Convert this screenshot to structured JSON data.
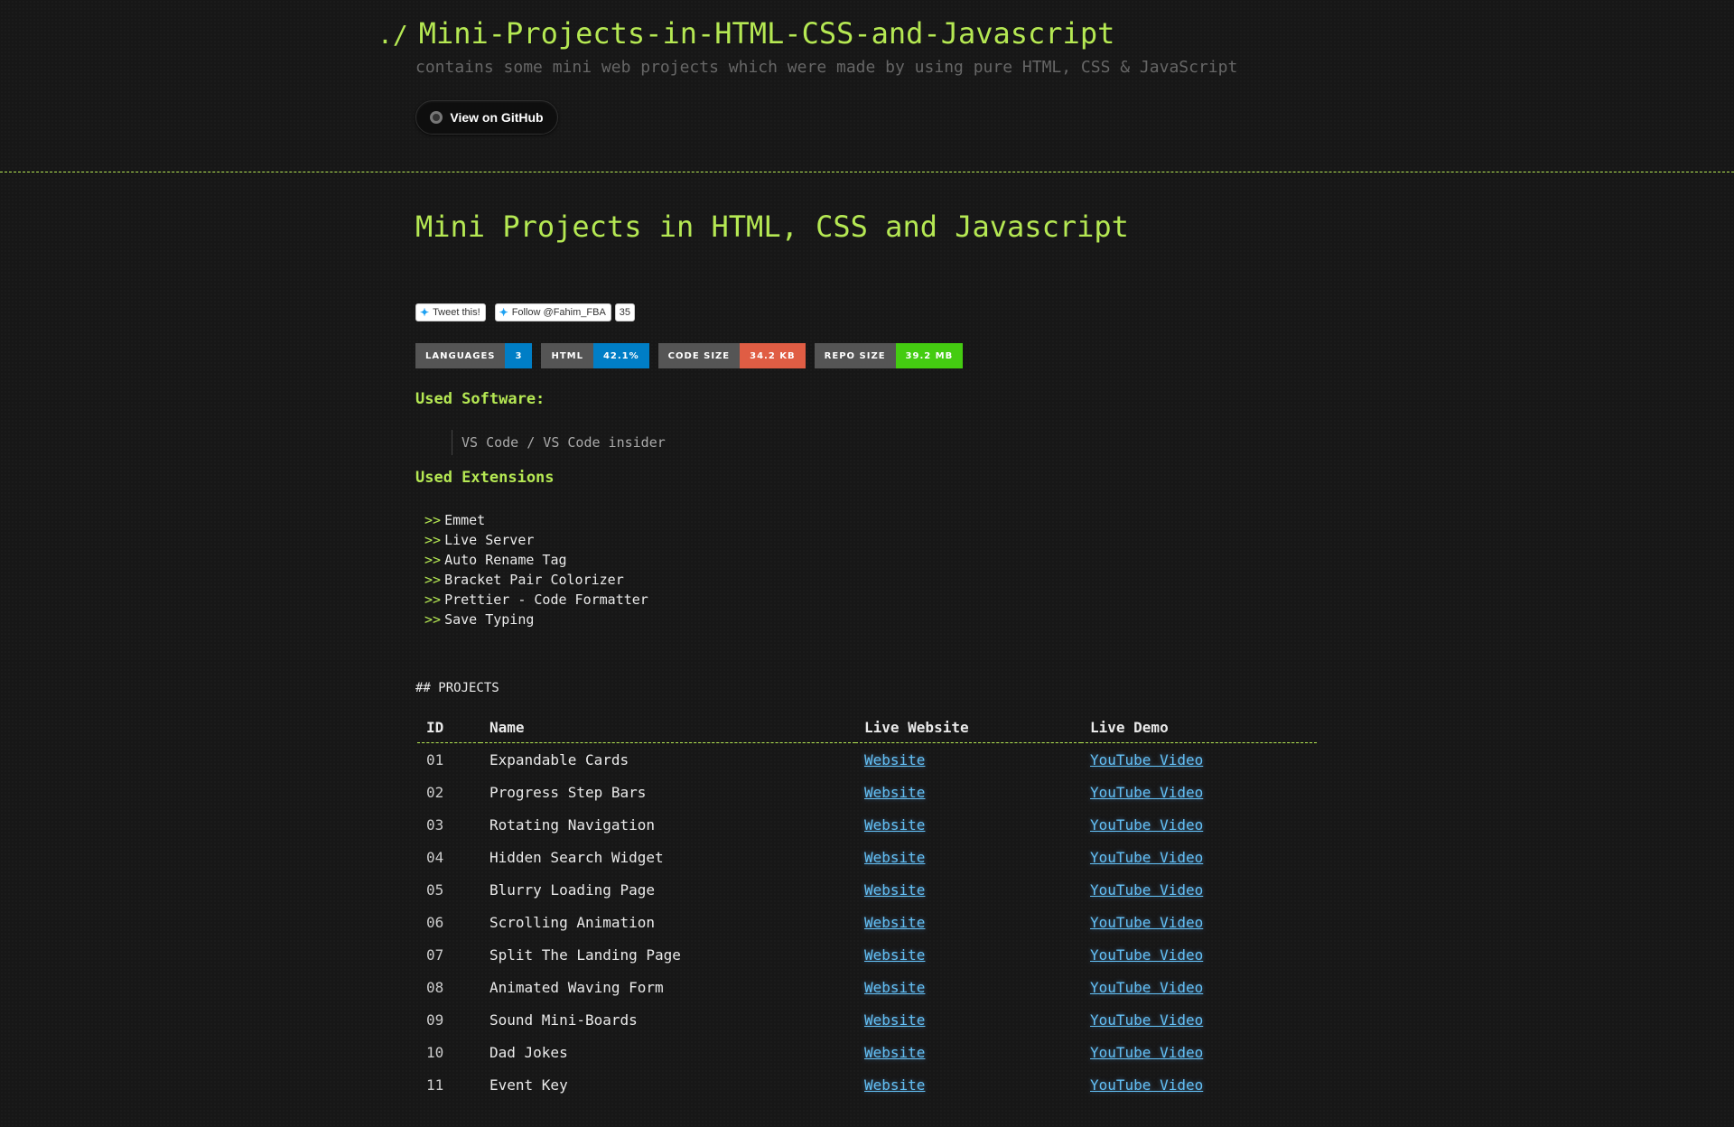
{
  "header": {
    "prompt": "./",
    "repo_title": "Mini-Projects-in-HTML-CSS-and-Javascript",
    "tagline": "contains some mini web projects which were made by using pure HTML, CSS & JavaScript",
    "github_button": "View on GitHub",
    "github_icon": "github-icon"
  },
  "main": {
    "heading": "Mini Projects in HTML, CSS and Javascript",
    "social": {
      "tweet_label": "Tweet this!",
      "follow_label": "Follow @Fahim_FBA",
      "follow_count": "35",
      "bird_icon": "twitter-bird-icon"
    },
    "badges": [
      {
        "label": "LANGUAGES",
        "value": "3",
        "color": "#007ec6"
      },
      {
        "label": "HTML",
        "value": "42.1%",
        "color": "#007ec6"
      },
      {
        "label": "CODE SIZE",
        "value": "34.2 KB",
        "color": "#e05d44"
      },
      {
        "label": "REPO SIZE",
        "value": "39.2 MB",
        "color": "#4c1"
      }
    ],
    "software_heading": "Used Software:",
    "software_item": "VS Code / VS Code insider",
    "extensions_heading": "Used Extensions",
    "extension_marker": ">>",
    "extensions": [
      "Emmet",
      "Live Server",
      "Auto Rename Tag",
      "Bracket Pair Colorizer",
      "Prettier - Code Formatter",
      "Save Typing"
    ],
    "projects_label": "## PROJECTS",
    "table": {
      "columns": [
        "ID",
        "Name",
        "Live Website",
        "Live Demo"
      ],
      "rows": [
        {
          "id": "01",
          "name": "Expandable Cards",
          "website": "Website",
          "demo": "YouTube Video"
        },
        {
          "id": "02",
          "name": "Progress Step Bars",
          "website": "Website",
          "demo": "YouTube Video"
        },
        {
          "id": "03",
          "name": "Rotating Navigation",
          "website": "Website",
          "demo": "YouTube Video"
        },
        {
          "id": "04",
          "name": "Hidden Search Widget",
          "website": "Website",
          "demo": "YouTube Video"
        },
        {
          "id": "05",
          "name": "Blurry Loading Page",
          "website": "Website",
          "demo": "YouTube Video"
        },
        {
          "id": "06",
          "name": "Scrolling Animation",
          "website": "Website",
          "demo": "YouTube Video"
        },
        {
          "id": "07",
          "name": "Split The Landing Page",
          "website": "Website",
          "demo": "YouTube Video"
        },
        {
          "id": "08",
          "name": "Animated Waving Form",
          "website": "Website",
          "demo": "YouTube Video"
        },
        {
          "id": "09",
          "name": "Sound Mini-Boards",
          "website": "Website",
          "demo": "YouTube Video"
        },
        {
          "id": "10",
          "name": "Dad Jokes",
          "website": "Website",
          "demo": "YouTube Video"
        },
        {
          "id": "11",
          "name": "Event Key",
          "website": "Website",
          "demo": "YouTube Video"
        }
      ]
    }
  }
}
